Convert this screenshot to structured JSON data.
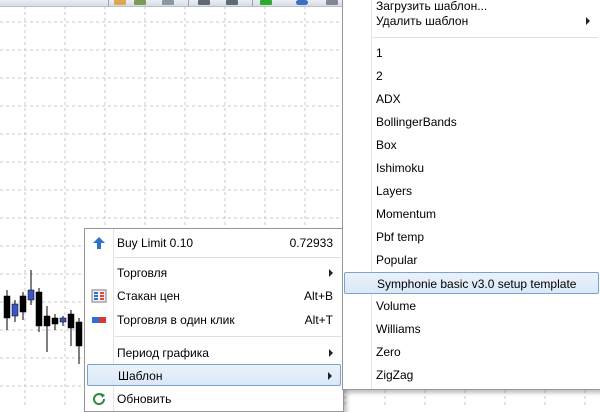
{
  "context_menu": {
    "items": [
      {
        "label": "Buy Limit 0.10",
        "shortcut": "0.72933",
        "icon": "buy-limit-arrow-icon"
      },
      {
        "label": "Торговля",
        "submenu": true
      },
      {
        "label": "Стакан цен",
        "shortcut": "Alt+B",
        "icon": "depth-of-market-icon"
      },
      {
        "label": "Торговля в один клик",
        "shortcut": "Alt+T",
        "icon": "one-click-trading-icon"
      },
      {
        "label": "Период графика",
        "submenu": true
      },
      {
        "label": "Шаблон",
        "submenu": true,
        "highlighted": true
      },
      {
        "label": "Обновить",
        "icon": "refresh-icon"
      }
    ]
  },
  "template_submenu": {
    "top_items": [
      {
        "label": "Загрузить шаблон..."
      },
      {
        "label": "Удалить шаблон",
        "submenu": true
      }
    ],
    "templates": [
      "1",
      "2",
      "ADX",
      "BollingerBands",
      "Box",
      "Ishimoku",
      "Layers",
      "Momentum",
      "Pbf temp",
      "Popular",
      "Symphonie basic v3.0 setup template",
      "Volume",
      "Williams",
      "Zero",
      "ZigZag"
    ],
    "highlighted_template": "Symphonie basic v3.0 setup template"
  },
  "colors": {
    "highlight_fill": "#d9e8f8",
    "highlight_border": "#7da2ce",
    "candle_bull": "#3a55c8",
    "candle_bear": "#000000",
    "grid": "#c8c8c8"
  }
}
